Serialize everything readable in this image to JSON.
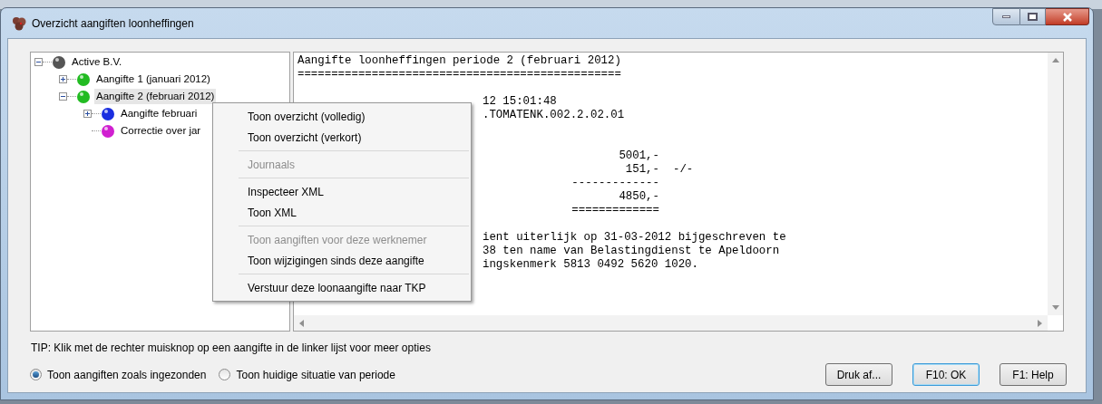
{
  "window": {
    "title": "Overzicht aangiften loonheffingen"
  },
  "tree": [
    {
      "label": "Active B.V.",
      "kind": "branch",
      "expanded": true,
      "selected": false,
      "color": "#555555",
      "children": [
        {
          "label": "Aangifte 1 (januari 2012)",
          "kind": "branch",
          "expanded": false,
          "selected": false,
          "color": "#22bb22"
        },
        {
          "label": "Aangifte 2 (februari 2012)",
          "kind": "branch",
          "expanded": true,
          "selected": true,
          "color": "#22bb22",
          "children": [
            {
              "label": "Aangifte februari",
              "kind": "branch",
              "expanded": false,
              "selected": false,
              "color": "#1a2ee0"
            },
            {
              "label": "Correctie over jar",
              "kind": "leaf",
              "selected": false,
              "color": "#d020d0"
            }
          ]
        }
      ]
    }
  ],
  "document": {
    "lines": [
      {
        "kind": "full",
        "text": "Aangifte loonheffingen periode 2 (februari 2012)"
      },
      {
        "kind": "full",
        "text": "================================================"
      },
      {
        "kind": "blank"
      },
      {
        "kind": "covered",
        "text": "12 15:01:48"
      },
      {
        "kind": "covered",
        "text": ".TOMATENK.002.2.02.01"
      },
      {
        "kind": "blank"
      },
      {
        "kind": "blank"
      },
      {
        "kind": "amount",
        "text": "5001,-"
      },
      {
        "kind": "amount",
        "text": "151,-",
        "suffix": "-/-"
      },
      {
        "kind": "amount",
        "text": "-------------"
      },
      {
        "kind": "amount",
        "text": "4850,-"
      },
      {
        "kind": "amount",
        "text": "============="
      },
      {
        "kind": "blank"
      },
      {
        "kind": "covered",
        "text": "ient uiterlijk op 31-03-2012 bijgeschreven te"
      },
      {
        "kind": "covered",
        "text": "38 ten name van Belastingdienst te Apeldoorn"
      },
      {
        "kind": "covered",
        "text": "ingskenmerk 5813 0492 5620 1020."
      }
    ]
  },
  "context_menu": [
    {
      "kind": "item",
      "label": "Toon overzicht (volledig)",
      "disabled": false
    },
    {
      "kind": "item",
      "label": "Toon overzicht (verkort)",
      "disabled": false
    },
    {
      "kind": "separator"
    },
    {
      "kind": "item",
      "label": "Journaals",
      "disabled": true
    },
    {
      "kind": "separator"
    },
    {
      "kind": "item",
      "label": "Inspecteer XML",
      "disabled": false
    },
    {
      "kind": "item",
      "label": "Toon XML",
      "disabled": false
    },
    {
      "kind": "separator"
    },
    {
      "kind": "item",
      "label": "Toon aangiften voor deze werknemer",
      "disabled": true
    },
    {
      "kind": "item",
      "label": "Toon wijzigingen sinds deze aangifte",
      "disabled": false
    },
    {
      "kind": "separator"
    },
    {
      "kind": "item",
      "label": "Verstuur deze loonaangifte naar TKP",
      "disabled": false
    }
  ],
  "tip": "TIP: Klik met de rechter muisknop op een aangifte in de linker lijst voor meer opties",
  "view_options": [
    {
      "label": "Toon aangiften zoals ingezonden",
      "selected": true
    },
    {
      "label": "Toon huidige situatie van periode",
      "selected": false
    }
  ],
  "buttons": [
    {
      "label": "Druk af...",
      "focused": false
    },
    {
      "label": "F10: OK",
      "focused": true
    },
    {
      "label": "F1: Help",
      "focused": false
    }
  ]
}
